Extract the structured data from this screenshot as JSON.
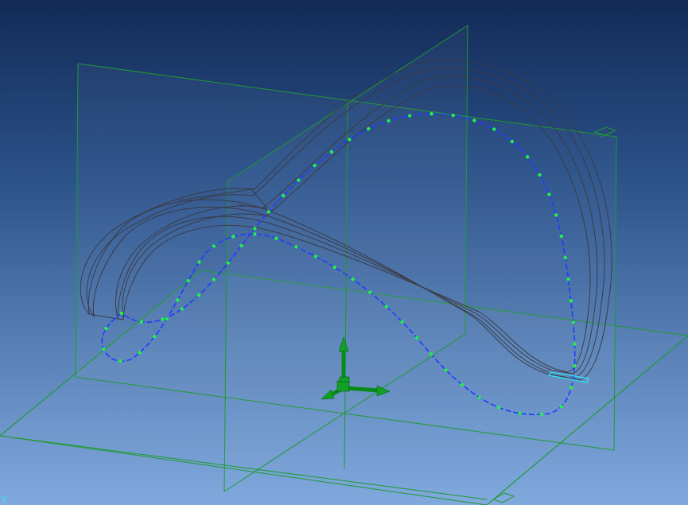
{
  "viewport": {
    "background_top": "#132a57",
    "background_bottom": "#80a9de"
  },
  "scene": {
    "plane_color": "#1e9a2e",
    "spline_color": "#1f3cff",
    "control_point_color": "#23f04a",
    "wireframe_color": "#3b3b46",
    "marker_color": "#2ee8ff",
    "triad_color": "#0fa024"
  },
  "corner_mark": "Y"
}
